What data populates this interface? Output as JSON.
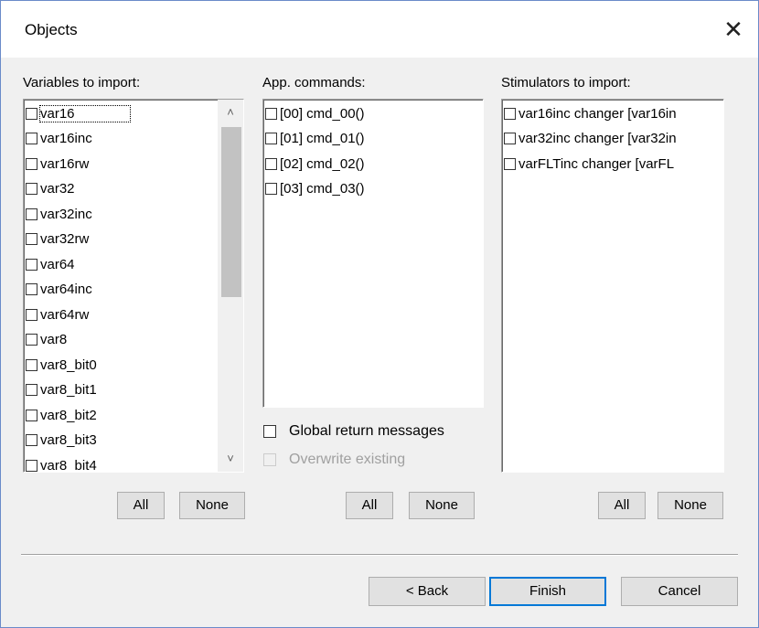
{
  "window": {
    "title": "Objects",
    "close_glyph": "✕"
  },
  "variables": {
    "label": "Variables to import:",
    "items": [
      "var16",
      "var16inc",
      "var16rw",
      "var32",
      "var32inc",
      "var32rw",
      "var64",
      "var64inc",
      "var64rw",
      "var8",
      "var8_bit0",
      "var8_bit1",
      "var8_bit2",
      "var8_bit3",
      "var8_bit4"
    ],
    "all_label": "All",
    "none_label": "None"
  },
  "commands": {
    "label": "App. commands:",
    "items": [
      "[00] cmd_00()",
      "[01] cmd_01()",
      "[02] cmd_02()",
      "[03] cmd_03()"
    ],
    "all_label": "All",
    "none_label": "None",
    "global_return_label": "Global return messages",
    "overwrite_label": "Overwrite existing"
  },
  "stimulators": {
    "label": "Stimulators to import:",
    "items": [
      "var16inc changer [var16in",
      "var32inc changer [var32in",
      "varFLTinc changer [varFL"
    ],
    "all_label": "All",
    "none_label": "None"
  },
  "footer": {
    "back_label": "< Back",
    "finish_label": "Finish",
    "cancel_label": "Cancel"
  },
  "icons": {
    "scroll_up": "chevron-up-icon",
    "scroll_down": "chevron-down-icon",
    "close": "close-icon"
  }
}
